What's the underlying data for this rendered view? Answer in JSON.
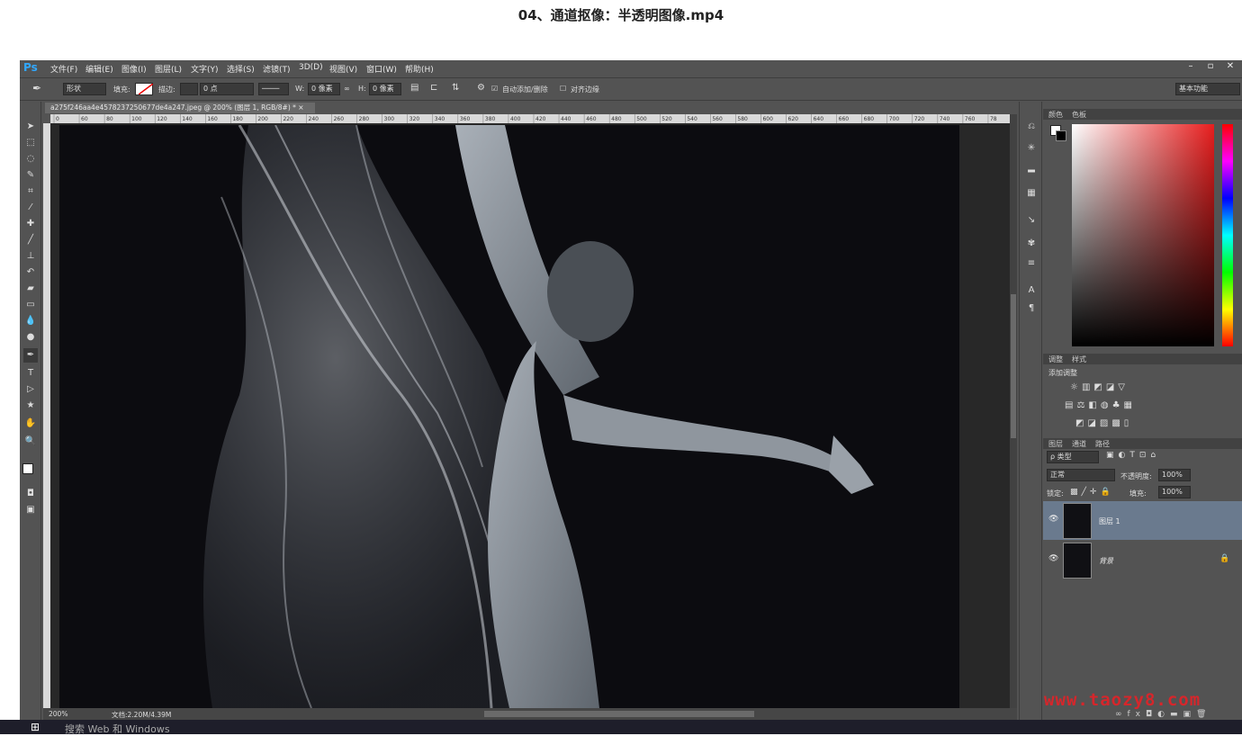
{
  "video": {
    "title": "04、通道抠像：半透明图像.mp4"
  },
  "app": {
    "logo": "Ps",
    "menu": [
      "文件(F)",
      "编辑(E)",
      "图像(I)",
      "图层(L)",
      "文字(Y)",
      "选择(S)",
      "滤镜(T)",
      "3D(D)",
      "视图(V)",
      "窗口(W)",
      "帮助(H)"
    ],
    "window_controls": {
      "minimize": "–",
      "restore": "▫",
      "close": "✕"
    }
  },
  "options": {
    "mode": "形状",
    "fill_label": "填充:",
    "stroke_label": "描边:",
    "stroke_size": "0 点",
    "w_label": "W:",
    "w_value": "0 像素",
    "h_label": "H:",
    "h_value": "0 像素",
    "auto_add_delete": "自动添加/删除",
    "align_edges": "对齐边缘",
    "workspace": "基本功能"
  },
  "document": {
    "tab_title": "a275f246aa4e4578237250677de4a247.jpeg @ 200% (图层 1, RGB/8#) * ×",
    "ruler_ticks": [
      "0",
      "60",
      "80",
      "100",
      "120",
      "140",
      "160",
      "180",
      "200",
      "220",
      "240",
      "260",
      "280",
      "300",
      "320",
      "340",
      "360",
      "380",
      "400",
      "420",
      "440",
      "460",
      "480",
      "500",
      "520",
      "540",
      "560",
      "580",
      "600",
      "620",
      "640",
      "660",
      "680",
      "700",
      "720",
      "740",
      "760",
      "78"
    ]
  },
  "status": {
    "zoom": "200%",
    "doc_size": "文档:2.20M/4.39M"
  },
  "panels": {
    "color_tabs": [
      "颜色",
      "色板"
    ],
    "adjust_tabs": [
      "调整",
      "样式"
    ],
    "adjust_heading": "添加调整",
    "layers_tabs": [
      "图层",
      "通道",
      "路径"
    ],
    "filter_kind": "ρ 类型",
    "blend_mode": "正常",
    "opacity_label": "不透明度:",
    "opacity_value": "100%",
    "lock_label": "锁定:",
    "fill_label": "填充:",
    "fill_value": "100%",
    "layers": [
      {
        "name": "图层 1",
        "selected": true
      },
      {
        "name": "背景",
        "selected": false
      }
    ]
  },
  "overlay": {
    "watermark": "www.taozy8.com"
  },
  "taskbar": {
    "search_placeholder": "搜索 Web 和 Windows"
  },
  "colors": {
    "accent": "#31a8ff",
    "selected_layer": "#6a7a8e",
    "watermark": "#d6262b"
  }
}
